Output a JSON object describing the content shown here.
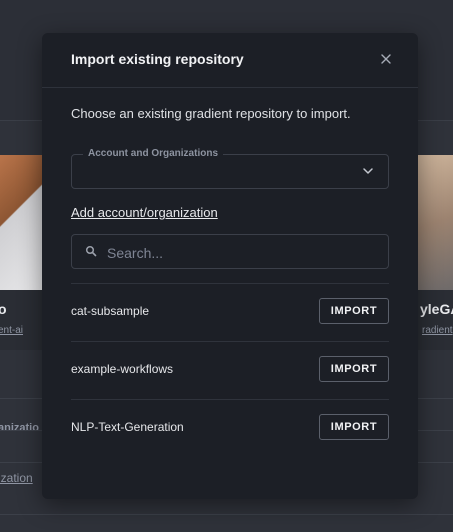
{
  "background": {
    "card_left": {
      "title": "o",
      "subtitle": "ent-ai"
    },
    "card_right": {
      "title": "yleGA",
      "subtitle": "radient"
    },
    "row1_text": "anizatio",
    "row2_text": "ization"
  },
  "modal": {
    "title": "Import existing repository",
    "description": "Choose an existing gradient repository to import.",
    "account_select": {
      "label": "Account and Organizations",
      "value": ""
    },
    "add_link": "Add account/organization",
    "search": {
      "placeholder": "Search...",
      "value": ""
    },
    "repositories": [
      {
        "name": "cat-subsample",
        "action": "IMPORT"
      },
      {
        "name": "example-workflows",
        "action": "IMPORT"
      },
      {
        "name": "NLP-Text-Generation",
        "action": "IMPORT"
      }
    ]
  },
  "icons": {
    "close": "close-icon",
    "chevron": "chevron-down-icon",
    "search": "search-icon"
  },
  "colors": {
    "modal_bg": "#1c1f26",
    "page_bg": "#2f323a",
    "border": "#3b3f49",
    "text": "#e8e9ec",
    "muted": "#8d93a0"
  }
}
